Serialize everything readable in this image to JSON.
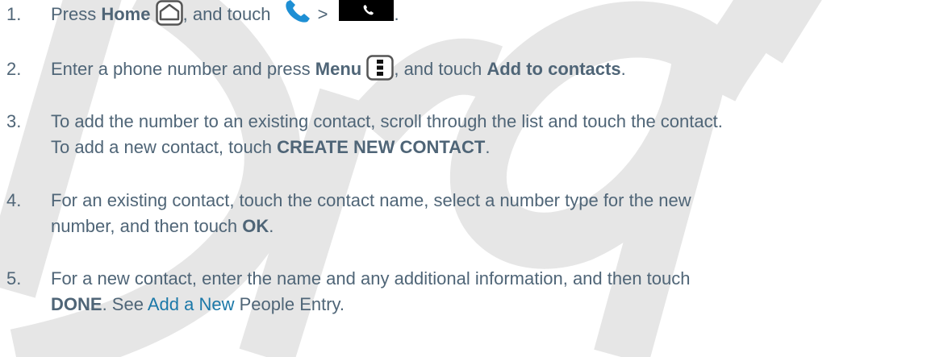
{
  "watermark_text": "Draft",
  "steps": [
    {
      "num": "1.",
      "t1": "Press ",
      "b1": "Home",
      "t2": ", and touch ",
      "sep": ">",
      "end": "."
    },
    {
      "num": "2.",
      "t1": "Enter a phone number and press ",
      "b1": "Menu",
      "t2": ", and touch ",
      "b2": "Add to contacts",
      "end": "."
    },
    {
      "num": "3.",
      "line1": "To add the number to an existing contact, scroll through the list and touch the contact.",
      "t1": "To add a new contact, touch ",
      "b1": "CREATE NEW CONTACT",
      "end": "."
    },
    {
      "num": "4.",
      "line1": "For an existing contact, touch the contact name, select a number type for the new",
      "t1": "number, and then touch ",
      "b1": "OK",
      "end": "."
    },
    {
      "num": "5.",
      "line1": "For a new contact, enter the name and any additional information, and then touch",
      "b1": "DONE",
      "t1": ". See ",
      "link": "Add a New",
      "t2": " People Entry."
    }
  ],
  "icons": {
    "home": "home-icon",
    "phone": "phone-icon",
    "dialer_button": "dialer-button",
    "menu": "menu-icon"
  },
  "colors": {
    "text": "#4f6577",
    "link": "#1b78a8",
    "watermark": "#e6e6e6",
    "phone_icon": "#1e8fd4"
  }
}
